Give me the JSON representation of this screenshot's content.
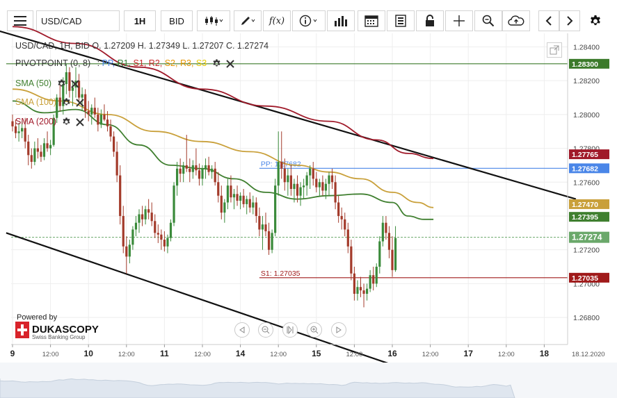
{
  "toolbar": {
    "symbol": "USD/CAD",
    "timeframe": "1H",
    "price_side": "BID",
    "fx_label": "f(x)"
  },
  "legend": {
    "ohlc": "USD/CAD, 1H, BID    O. 1.27209 H. 1.27349 L. 1.27207 C. 1.27274",
    "pivot_name": "PIVOTPOINT (0, 8)",
    "pivot_sep": ":",
    "pivot_labels": [
      "PP,",
      "R1,",
      "S1,",
      "R2,",
      "S2,",
      "R3,",
      "S3"
    ],
    "pivot_colors": [
      "#4a86e8",
      "#2e7d32",
      "#c62828",
      "#c62828",
      "#e69500",
      "#e69500",
      "#e6c800"
    ],
    "sma50": "SMA (50)",
    "sma100": "SMA (100)",
    "sma200": "SMA (200)"
  },
  "branding": {
    "powered_by": "Powered by",
    "name": "DUKASCOPY",
    "tagline": "Swiss Banking Group"
  },
  "colors": {
    "bull": "#3a8a3a",
    "bear": "#a33a2a",
    "sma50": "#3f7f2f",
    "sma100": "#c9a03a",
    "sma200": "#a01a2a",
    "pp": "#4a86e8",
    "r1": "#3b7a2a",
    "s1": "#a01a1a",
    "trend": "#111111",
    "current": "#6aa86a"
  },
  "chart_data": {
    "type": "candlestick",
    "ylim": [
      1.2664,
      1.2848
    ],
    "y_ticks": [
      1.268,
      1.27,
      1.272,
      1.274,
      1.276,
      1.278,
      1.28,
      1.282,
      1.284
    ],
    "y_tick_labels": [
      "1.26800",
      "1.27000",
      "1.27200",
      "1.27400",
      "1.27600",
      "1.27800",
      "1.28000",
      "1.28200",
      "1.28400"
    ],
    "x_tick_labels": [
      "9",
      "12:00",
      "10",
      "12:00",
      "11",
      "12:00",
      "14",
      "12:00",
      "15",
      "12:00",
      "16",
      "12:00",
      "17",
      "12:00",
      "18",
      "18.12.2020"
    ],
    "x_tick_bold": [
      true,
      false,
      true,
      false,
      true,
      false,
      true,
      false,
      true,
      false,
      true,
      false,
      true,
      false,
      true,
      false
    ],
    "x_tick_index": [
      0,
      12,
      24,
      36,
      48,
      60,
      72,
      84,
      96,
      108,
      120,
      132,
      144,
      156,
      168,
      178
    ],
    "candles_ohlc": [
      [
        1.2796,
        1.28,
        1.279,
        1.2793
      ],
      [
        1.2793,
        1.2797,
        1.2786,
        1.2789
      ],
      [
        1.2789,
        1.2795,
        1.2784,
        1.279
      ],
      [
        1.279,
        1.2796,
        1.2786,
        1.2792
      ],
      [
        1.2792,
        1.2798,
        1.278,
        1.2784
      ],
      [
        1.2784,
        1.2788,
        1.277,
        1.2776
      ],
      [
        1.2776,
        1.278,
        1.2768,
        1.2772
      ],
      [
        1.2772,
        1.2784,
        1.277,
        1.278
      ],
      [
        1.278,
        1.2786,
        1.2774,
        1.2778
      ],
      [
        1.2778,
        1.2782,
        1.2772,
        1.2775
      ],
      [
        1.2775,
        1.2786,
        1.2773,
        1.2783
      ],
      [
        1.2783,
        1.279,
        1.2778,
        1.278
      ],
      [
        1.278,
        1.2785,
        1.2776,
        1.2782
      ],
      [
        1.2782,
        1.28,
        1.2781,
        1.2798
      ],
      [
        1.2798,
        1.2812,
        1.2795,
        1.281
      ],
      [
        1.281,
        1.2818,
        1.2802,
        1.2805
      ],
      [
        1.2805,
        1.2822,
        1.28,
        1.2818
      ],
      [
        1.2818,
        1.283,
        1.2812,
        1.2825
      ],
      [
        1.2825,
        1.2828,
        1.281,
        1.2814
      ],
      [
        1.2814,
        1.282,
        1.2805,
        1.2816
      ],
      [
        1.2816,
        1.2828,
        1.281,
        1.282
      ],
      [
        1.282,
        1.2824,
        1.2806,
        1.281
      ],
      [
        1.281,
        1.2816,
        1.2802,
        1.2812
      ],
      [
        1.2812,
        1.2815,
        1.2798,
        1.2802
      ],
      [
        1.2802,
        1.2808,
        1.2796,
        1.28
      ],
      [
        1.28,
        1.2806,
        1.2794,
        1.2804
      ],
      [
        1.2804,
        1.281,
        1.2798,
        1.28
      ],
      [
        1.28,
        1.2804,
        1.279,
        1.2794
      ],
      [
        1.2794,
        1.2803,
        1.2792,
        1.28
      ],
      [
        1.28,
        1.2806,
        1.2796,
        1.2797
      ],
      [
        1.2797,
        1.2802,
        1.279,
        1.2793
      ],
      [
        1.2793,
        1.2797,
        1.2784,
        1.2787
      ],
      [
        1.2787,
        1.279,
        1.2775,
        1.2778
      ],
      [
        1.2778,
        1.2784,
        1.276,
        1.2764
      ],
      [
        1.2764,
        1.277,
        1.2735,
        1.274
      ],
      [
        1.274,
        1.2746,
        1.2718,
        1.2722
      ],
      [
        1.2722,
        1.2728,
        1.2706,
        1.2716
      ],
      [
        1.2716,
        1.2726,
        1.2712,
        1.2723
      ],
      [
        1.2723,
        1.2734,
        1.272,
        1.2732
      ],
      [
        1.2732,
        1.274,
        1.2728,
        1.2736
      ],
      [
        1.2736,
        1.2744,
        1.273,
        1.2741
      ],
      [
        1.2741,
        1.2746,
        1.2734,
        1.2738
      ],
      [
        1.2738,
        1.2746,
        1.2735,
        1.2744
      ],
      [
        1.2744,
        1.275,
        1.2738,
        1.2742
      ],
      [
        1.2742,
        1.2748,
        1.2734,
        1.2737
      ],
      [
        1.2737,
        1.2741,
        1.2727,
        1.273
      ],
      [
        1.273,
        1.2735,
        1.2724,
        1.2729
      ],
      [
        1.2729,
        1.2732,
        1.272,
        1.2726
      ],
      [
        1.2726,
        1.2731,
        1.2719,
        1.2722
      ],
      [
        1.2722,
        1.2729,
        1.2718,
        1.2727
      ],
      [
        1.2727,
        1.2738,
        1.2725,
        1.2736
      ],
      [
        1.2736,
        1.276,
        1.2734,
        1.2758
      ],
      [
        1.2758,
        1.2772,
        1.2752,
        1.2768
      ],
      [
        1.2768,
        1.2774,
        1.276,
        1.2765
      ],
      [
        1.2765,
        1.2772,
        1.276,
        1.277
      ],
      [
        1.277,
        1.2788,
        1.2766,
        1.2768
      ],
      [
        1.2768,
        1.2774,
        1.276,
        1.2766
      ],
      [
        1.2766,
        1.2773,
        1.2762,
        1.277
      ],
      [
        1.277,
        1.278,
        1.2764,
        1.2767
      ],
      [
        1.2767,
        1.2771,
        1.2758,
        1.2762
      ],
      [
        1.2762,
        1.277,
        1.2758,
        1.2768
      ],
      [
        1.2768,
        1.2774,
        1.2762,
        1.277
      ],
      [
        1.277,
        1.2775,
        1.2764,
        1.2766
      ],
      [
        1.2766,
        1.277,
        1.2762,
        1.2768
      ],
      [
        1.2768,
        1.2772,
        1.2758,
        1.276
      ],
      [
        1.276,
        1.2766,
        1.2748,
        1.2752
      ],
      [
        1.2752,
        1.2758,
        1.2738,
        1.2742
      ],
      [
        1.2742,
        1.275,
        1.2736,
        1.2748
      ],
      [
        1.2748,
        1.2762,
        1.2744,
        1.2758
      ],
      [
        1.2758,
        1.2764,
        1.2748,
        1.2751
      ],
      [
        1.2751,
        1.2756,
        1.2744,
        1.2753
      ],
      [
        1.2753,
        1.2758,
        1.2746,
        1.2749
      ],
      [
        1.2749,
        1.2754,
        1.2744,
        1.2752
      ],
      [
        1.2752,
        1.2756,
        1.2745,
        1.2747
      ],
      [
        1.2747,
        1.2752,
        1.2741,
        1.275
      ],
      [
        1.275,
        1.2754,
        1.2742,
        1.2745
      ],
      [
        1.2745,
        1.2752,
        1.2741,
        1.2748
      ],
      [
        1.2748,
        1.2751,
        1.2736,
        1.274
      ],
      [
        1.274,
        1.2745,
        1.2728,
        1.2732
      ],
      [
        1.2732,
        1.274,
        1.272,
        1.2735
      ],
      [
        1.2735,
        1.2742,
        1.2728,
        1.2731
      ],
      [
        1.2731,
        1.2736,
        1.2717,
        1.272
      ],
      [
        1.272,
        1.2732,
        1.2718,
        1.273
      ],
      [
        1.273,
        1.2762,
        1.2728,
        1.2758
      ],
      [
        1.2758,
        1.279,
        1.2752,
        1.2772
      ],
      [
        1.2772,
        1.279,
        1.2762,
        1.2768
      ],
      [
        1.2768,
        1.2774,
        1.2755,
        1.276
      ],
      [
        1.276,
        1.2768,
        1.2752,
        1.2764
      ],
      [
        1.2764,
        1.277,
        1.2752,
        1.2756
      ],
      [
        1.2756,
        1.2762,
        1.2748,
        1.2759
      ],
      [
        1.2759,
        1.2764,
        1.2748,
        1.2752
      ],
      [
        1.2752,
        1.276,
        1.2746,
        1.2757
      ],
      [
        1.2757,
        1.2762,
        1.275,
        1.2758
      ],
      [
        1.2758,
        1.2766,
        1.2752,
        1.2764
      ],
      [
        1.2764,
        1.277,
        1.2756,
        1.2768
      ],
      [
        1.2768,
        1.2772,
        1.2758,
        1.2762
      ],
      [
        1.2762,
        1.2766,
        1.2754,
        1.2757
      ],
      [
        1.2757,
        1.2762,
        1.2752,
        1.276
      ],
      [
        1.276,
        1.2764,
        1.2752,
        1.2755
      ],
      [
        1.2755,
        1.2762,
        1.275,
        1.2759
      ],
      [
        1.2759,
        1.2766,
        1.2752,
        1.2764
      ],
      [
        1.2764,
        1.2768,
        1.2756,
        1.276
      ],
      [
        1.276,
        1.2764,
        1.2744,
        1.2748
      ],
      [
        1.2748,
        1.2752,
        1.2736,
        1.274
      ],
      [
        1.274,
        1.2745,
        1.2732,
        1.2738
      ],
      [
        1.2738,
        1.2742,
        1.2728,
        1.2732
      ],
      [
        1.2732,
        1.2736,
        1.2718,
        1.2722
      ],
      [
        1.2722,
        1.2726,
        1.2702,
        1.2706
      ],
      [
        1.2706,
        1.271,
        1.269,
        1.2694
      ],
      [
        1.2694,
        1.2702,
        1.269,
        1.2698
      ],
      [
        1.2698,
        1.2704,
        1.2692,
        1.2696
      ],
      [
        1.2696,
        1.27,
        1.2686,
        1.2694
      ],
      [
        1.2694,
        1.27,
        1.269,
        1.2697
      ],
      [
        1.2697,
        1.2708,
        1.2695,
        1.2705
      ],
      [
        1.2705,
        1.271,
        1.2696,
        1.27
      ],
      [
        1.27,
        1.2712,
        1.2698,
        1.271
      ],
      [
        1.271,
        1.2728,
        1.2706,
        1.2725
      ],
      [
        1.2725,
        1.274,
        1.2722,
        1.2736
      ],
      [
        1.2736,
        1.274,
        1.2726,
        1.273
      ],
      [
        1.273,
        1.2734,
        1.2715,
        1.272
      ],
      [
        1.272,
        1.2728,
        1.2704,
        1.2708
      ],
      [
        1.2708,
        1.2734,
        1.2707,
        1.2727
      ]
    ],
    "sma50_path": [
      [
        0,
        1.2808
      ],
      [
        10,
        1.2801
      ],
      [
        20,
        1.2803
      ],
      [
        30,
        1.2794
      ],
      [
        40,
        1.2782
      ],
      [
        50,
        1.277
      ],
      [
        60,
        1.2768
      ],
      [
        70,
        1.2762
      ],
      [
        80,
        1.2754
      ],
      [
        90,
        1.275
      ],
      [
        100,
        1.2752
      ],
      [
        110,
        1.2753
      ],
      [
        120,
        1.2748
      ],
      [
        125,
        1.274
      ],
      [
        130,
        1.2738
      ],
      [
        133,
        1.2738
      ]
    ],
    "sma100_path": [
      [
        0,
        1.2815
      ],
      [
        15,
        1.2808
      ],
      [
        30,
        1.28
      ],
      [
        45,
        1.279
      ],
      [
        60,
        1.2784
      ],
      [
        75,
        1.2778
      ],
      [
        90,
        1.277
      ],
      [
        100,
        1.2766
      ],
      [
        110,
        1.2762
      ],
      [
        120,
        1.2754
      ],
      [
        128,
        1.2748
      ],
      [
        133,
        1.2745
      ]
    ],
    "sma200_path": [
      [
        0,
        1.2852
      ],
      [
        20,
        1.2842
      ],
      [
        40,
        1.2828
      ],
      [
        60,
        1.2815
      ],
      [
        80,
        1.2805
      ],
      [
        100,
        1.2796
      ],
      [
        115,
        1.2785
      ],
      [
        125,
        1.2777
      ],
      [
        133,
        1.2774
      ]
    ],
    "trend_upper": [
      [
        -20,
        1.2858
      ],
      [
        178,
        1.275
      ]
    ],
    "trend_lower": [
      [
        -2,
        1.273
      ],
      [
        120,
        1.2652
      ]
    ],
    "levels": [
      {
        "name": "R1",
        "value": 1.283,
        "label": "1.28300",
        "color": "#3b7a2a",
        "line_start": -2
      },
      {
        "name": "PP",
        "value": 1.27682,
        "label": "1.27682",
        "text": "PP: 1.27682",
        "color": "#4a86e8",
        "line_start": 78
      },
      {
        "name": "S1",
        "value": 1.27035,
        "label": "1.27035",
        "text": "S1: 1.27035",
        "color": "#a01a1a",
        "line_start": 78
      }
    ],
    "price_tags": [
      {
        "value": 1.27765,
        "label": "1.27765",
        "color": "#a01a2a"
      },
      {
        "value": 1.2747,
        "label": "1.27470",
        "color": "#c9a03a"
      },
      {
        "value": 1.27395,
        "label": "1.27395",
        "color": "#3f7f2f"
      },
      {
        "value": 1.27274,
        "label": "1.27274",
        "color": "#6aa86a"
      }
    ],
    "current_price": 1.27274,
    "date_label": "18.12.2020",
    "grid": true
  }
}
